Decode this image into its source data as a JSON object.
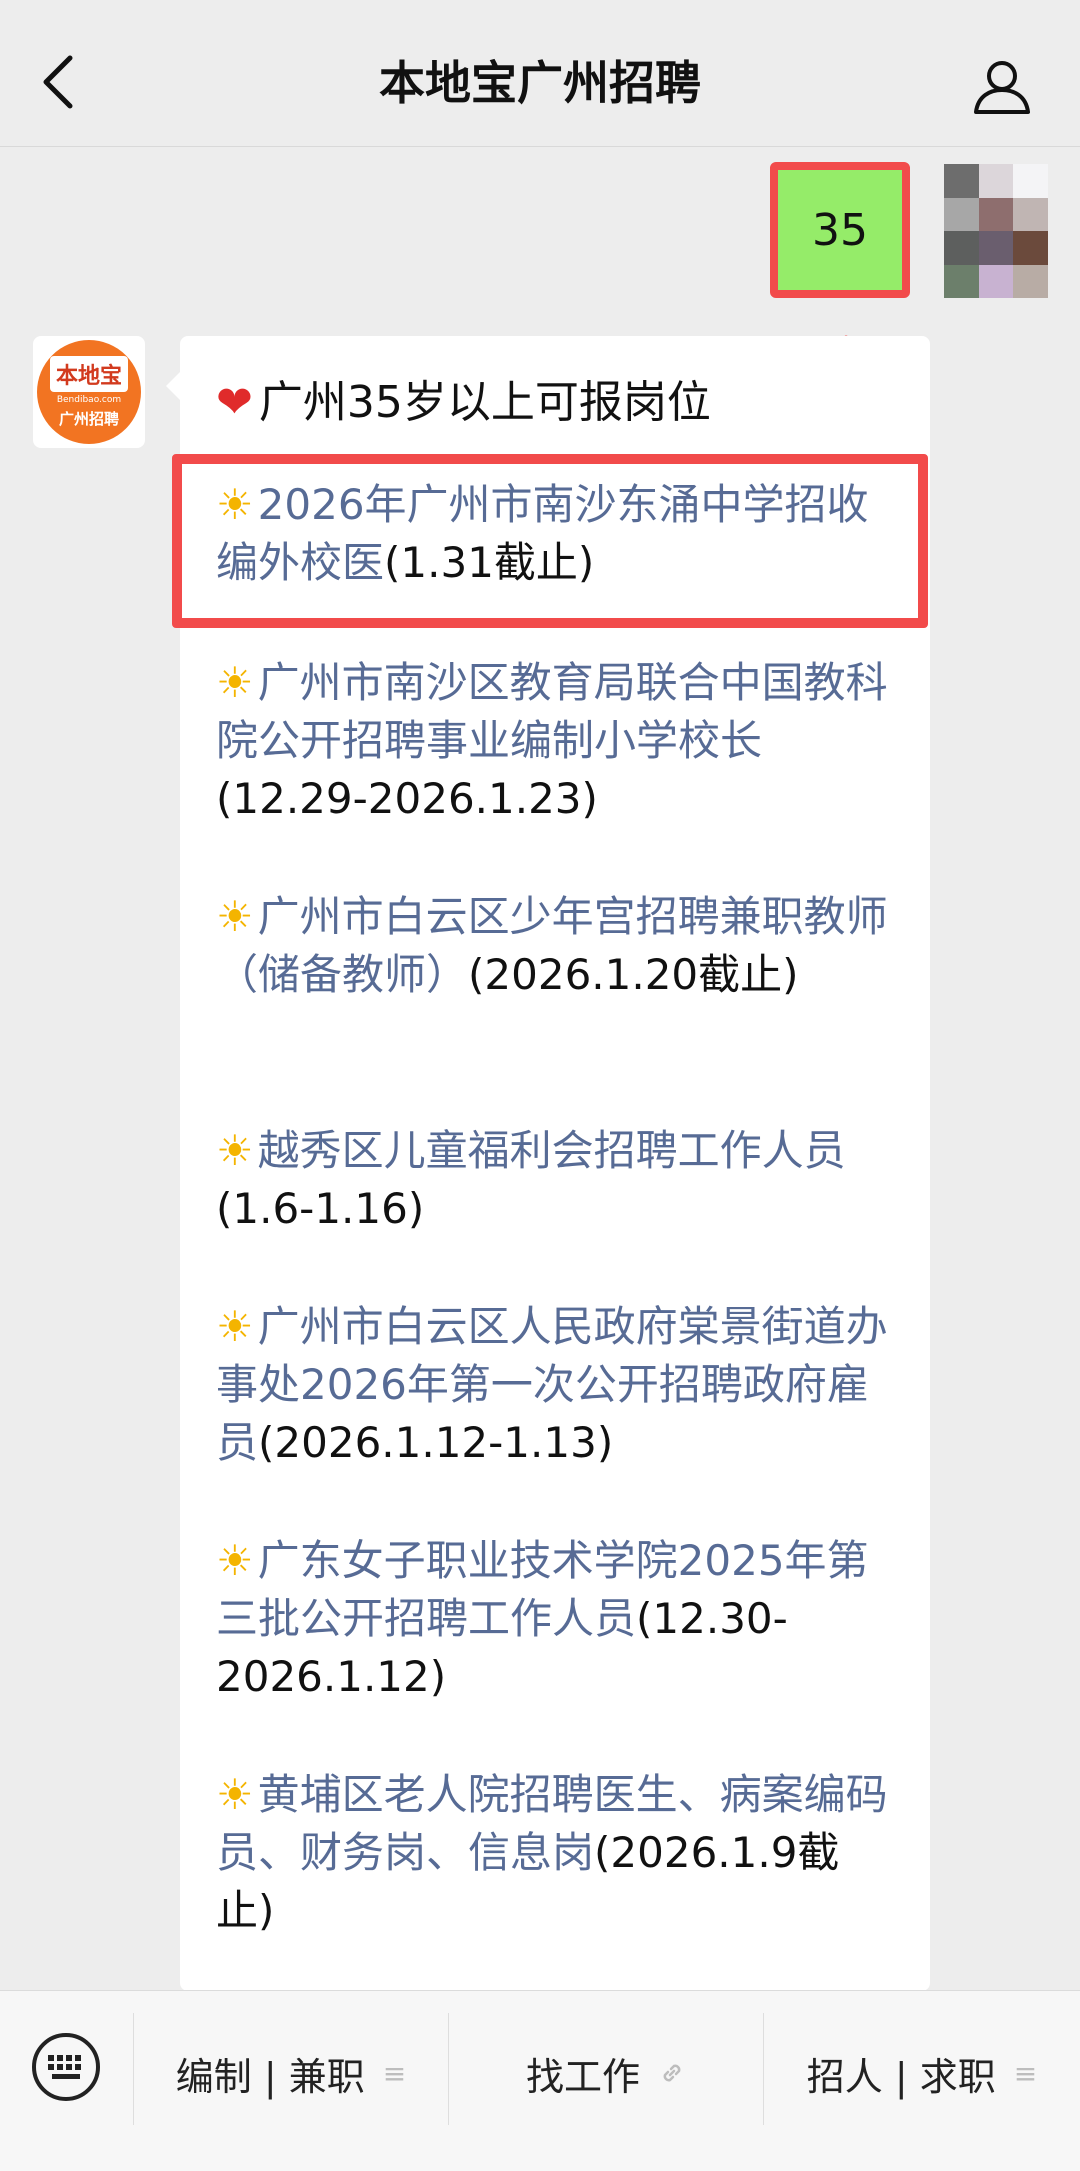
{
  "header": {
    "title": "本地宝广州招聘"
  },
  "my_message": {
    "text": "35"
  },
  "bot": {
    "avatar_logo": "本地宝",
    "avatar_domain": "Bendibao.com",
    "avatar_city": "广州招聘"
  },
  "bot_message": {
    "heading": "广州35岁以上可报岗位",
    "jobs": [
      {
        "link": "2026年广州市南沙东涌中学招收编外校医",
        "note": "(1.31截止)"
      },
      {
        "link": "广州市南沙区教育局联合中国教科院公开招聘事业编制小学校长",
        "note": "(12.29-2026.1.23)"
      },
      {
        "link": "广州市白云区少年宫招聘兼职教师（储备教师）",
        "note": "(2026.1.20截止)"
      },
      {
        "link": "越秀区儿童福利会招聘工作人员",
        "note": "(1.6-1.16)"
      },
      {
        "link": "广州市白云区人民政府棠景街道办事处2026年第一次公开招聘政府雇员",
        "note": "(2026.1.12-1.13)"
      },
      {
        "link": "广东女子职业技术学院2025年第三批公开招聘工作人员",
        "note": "(12.30-2026.1.12)"
      },
      {
        "link": "黄埔区老人院招聘医生、病案编码员、财务岗、信息岗",
        "note": "(2026.1.9截止)"
      }
    ]
  },
  "bottom_menu": {
    "items": [
      "编制 | 兼职",
      "找工作",
      "招人 | 求职"
    ]
  },
  "icons": {
    "heart": "❤",
    "sun": "☀",
    "menu_lines": "≡",
    "link": "🔗"
  },
  "colors": {
    "link": "#576b95",
    "my_bubble": "#95ec69",
    "highlight": "#f24b4b",
    "brand": "#f27422"
  }
}
